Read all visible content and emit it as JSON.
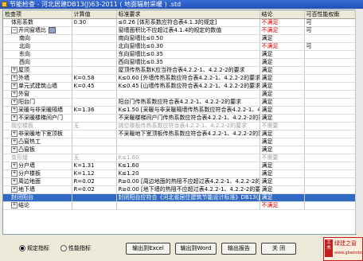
{
  "window": {
    "title": "节能检查 - 河北居建DB13(J)63-2011 ( 地面辐射采暖 ) .std"
  },
  "columns": [
    "检查项",
    "计算值",
    "标准要求",
    "结论",
    "可否性能权衡"
  ],
  "rows": [
    {
      "expander": "",
      "name": "体形系数",
      "value": "0.30",
      "req": "≤0.26 [体形系数应符合表4.1.3的规定]",
      "result": "不满足",
      "option": "可"
    },
    {
      "expander": "−",
      "name": "开间窗墙比",
      "value": "",
      "req": "窗墙面积比不应超过表4.1.4的规定的数值",
      "result": "不满足",
      "option": "可"
    },
    {
      "expander": "",
      "name": "南向",
      "value": "",
      "req": "南向窗墙比≤0.50",
      "result": "满足",
      "option": ""
    },
    {
      "expander": "",
      "name": "北向",
      "value": "",
      "req": "北向窗墙比≤0.30",
      "result": "不满足",
      "option": "可"
    },
    {
      "expander": "",
      "name": "东向",
      "value": "",
      "req": "东向窗墙比≤0.35",
      "result": "满足",
      "option": ""
    },
    {
      "expander": "",
      "name": "西向",
      "value": "",
      "req": "西向窗墙比≤0.35",
      "result": "满足",
      "option": ""
    },
    {
      "expander": "+",
      "name": "屋顶",
      "value": "",
      "req": "屋顶传热系数K应当符合表4.2.2-1、4.2.2-2的要求",
      "result": "满足",
      "option": ""
    },
    {
      "expander": "+",
      "name": "外墙",
      "value": "K=0.58",
      "req": "K≤0.60 [外墙传热系数应符合表4.2.2-1、4.2.2-2的要求]",
      "result": "满足",
      "option": ""
    },
    {
      "expander": "+",
      "name": "单元式建筑山墙",
      "value": "K=0.45",
      "req": "K≤0.45 [山墙传热系数应符合表4.2.2-1、4.2.2-2的要求]",
      "result": "满足",
      "option": ""
    },
    {
      "expander": "+",
      "name": "外窗",
      "value": "",
      "req": "",
      "result": "满足",
      "option": ""
    },
    {
      "expander": "+",
      "name": "阳台门",
      "value": "",
      "req": "阳台门传热系数应符合表4.2.2-1、4.2.2-2的要求",
      "result": "满足",
      "option": ""
    },
    {
      "expander": "+",
      "name": "采暖与非采暖隔墙",
      "value": "K=1.36",
      "req": "K≤1.50 [采暖与非采暖隔墙传热系数应符合表4.2.2-1、4.2.2-2的要求]",
      "result": "满足",
      "option": ""
    },
    {
      "expander": "+",
      "name": "不采暖楼梯间户门",
      "value": "",
      "req": "不采暖楼梯间户门传热系数应符合表4.2.2-1、4.2.2-2的要求",
      "result": "满足",
      "option": ""
    },
    {
      "expander": "",
      "name": "挑空楼板",
      "value": "无",
      "req": "挑空楼板传热系数应符合表4.2.2-1、4.2.2-2的要求",
      "result": "不需要",
      "option": "",
      "gray": true
    },
    {
      "expander": "+",
      "name": "非采暖地下室顶板",
      "value": "",
      "req": "不采暖地下室顶板传热系数应符合表4.2.2-1、4.2.2-2的要求",
      "result": "满足",
      "option": ""
    },
    {
      "expander": "+",
      "name": "凸窗热工",
      "value": "",
      "req": "",
      "result": "满足",
      "option": ""
    },
    {
      "expander": "+",
      "name": "凸窗板",
      "value": "",
      "req": "",
      "result": "满足",
      "option": ""
    },
    {
      "expander": "",
      "name": "变形缝",
      "value": "无",
      "req": "K≤1.60",
      "result": "不需要",
      "option": "",
      "gray": true
    },
    {
      "expander": "+",
      "name": "分户墙",
      "value": "K=1.31",
      "req": "K≤1.60",
      "result": "满足",
      "option": ""
    },
    {
      "expander": "+",
      "name": "分户楼板",
      "value": "K=1.12",
      "req": "K≤1.20",
      "result": "满足",
      "option": ""
    },
    {
      "expander": "+",
      "name": "周边地面",
      "value": "R=0.02",
      "req": "R≥0.00 [周边地面的热阻不应超过表4.2.2-1、4.2.2-2的要求]",
      "result": "满足",
      "option": ""
    },
    {
      "expander": "+",
      "name": "地下墙",
      "value": "R=0.02",
      "req": "R≥0.00 [地下墙的热阻不应超过表4.2.2-1、4.2.2-2的要求]",
      "result": "满足",
      "option": ""
    },
    {
      "expander": "",
      "name": "封闭阳台",
      "value": "",
      "req": "封闭阳台应符合《河北省居住建筑节能设计标准》DB13(J)63-2011",
      "result": "满足",
      "option": "",
      "selected": true
    },
    {
      "expander": "+",
      "name": "结论",
      "value": "",
      "req": "",
      "result": "不满足",
      "option": ""
    }
  ],
  "radios": [
    {
      "label": "规定指标",
      "checked": true
    },
    {
      "label": "性能指标",
      "checked": false
    }
  ],
  "buttons": {
    "excel": "输出到Excel",
    "word": "输出到Word",
    "report": "输出报告",
    "close": "关 闭"
  },
  "logo": {
    "mark": "土木",
    "text": "绿建之窗",
    "sub": "www.gbwindows.cn"
  }
}
